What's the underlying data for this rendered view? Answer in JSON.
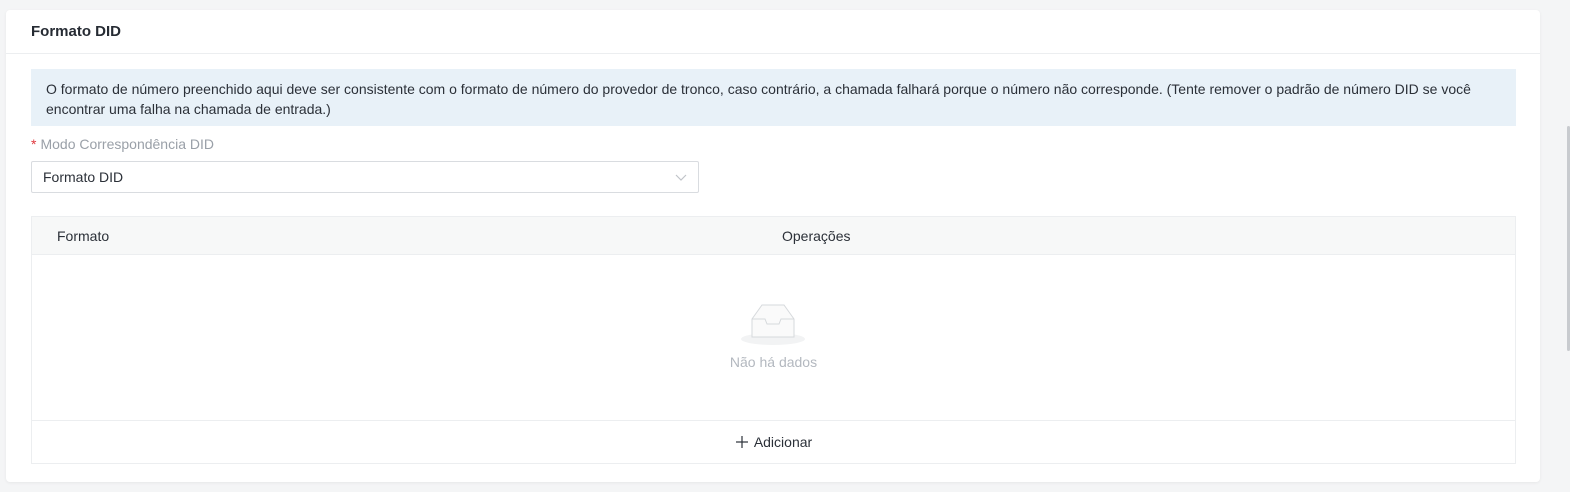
{
  "section": {
    "title": "Formato DID"
  },
  "info": {
    "text": "O formato de número preenchido aqui deve ser consistente com o formato de número do provedor de tronco, caso contrário, a chamada falhará porque o número não corresponde. (Tente remover o padrão de número DID se você encontrar uma falha na chamada de entrada.)"
  },
  "field": {
    "required_mark": "*",
    "label": "Modo Correspondência DID",
    "value": "Formato DID",
    "icon": "chevron-down-icon"
  },
  "table": {
    "columns": [
      "Formato",
      "Operações"
    ],
    "empty_text": "Não há dados",
    "empty_icon": "empty-inbox-icon",
    "add_label": "Adicionar",
    "add_icon": "plus-icon"
  },
  "colors": {
    "info_bg": "#e8f1f8",
    "required": "#e0383e",
    "muted_text": "#9aa0a8"
  }
}
